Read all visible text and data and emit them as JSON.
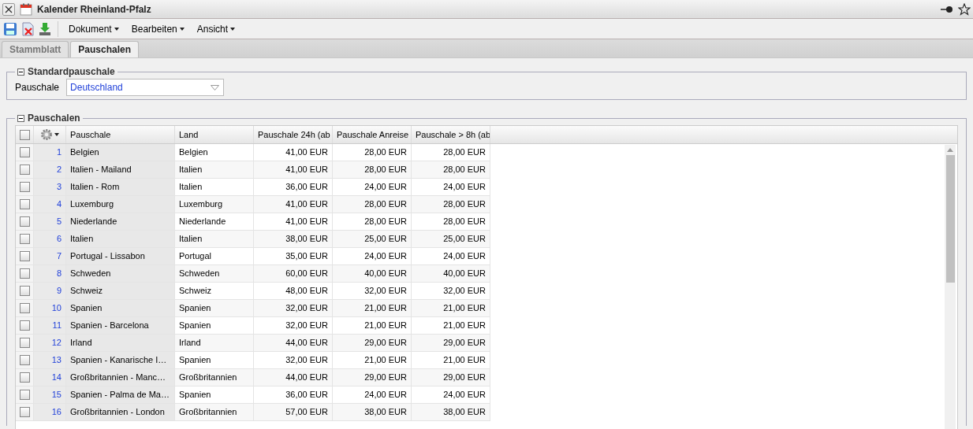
{
  "window": {
    "title": "Kalender Rheinland-Pfalz"
  },
  "menus": [
    "Dokument",
    "Bearbeiten",
    "Ansicht"
  ],
  "tabs": [
    {
      "label": "Stammblatt",
      "selected": false
    },
    {
      "label": "Pauschalen",
      "selected": true
    }
  ],
  "standard": {
    "legend": "Standardpauschale",
    "label": "Pauschale",
    "value": "Deutschland"
  },
  "table": {
    "legend": "Pauschalen",
    "all_checked": false,
    "columns": [
      "Pauschale",
      "Land",
      "Pauschale 24h (ab",
      "Pauschale Anreise",
      "Pauschale > 8h (ab"
    ],
    "rows": [
      {
        "no": "1",
        "name": "Belgien",
        "land": "Belgien",
        "p24": "41,00 EUR",
        "anreise": "28,00 EUR",
        "p8": "28,00 EUR",
        "checked": false
      },
      {
        "no": "2",
        "name": "Italien - Mailand",
        "land": "Italien",
        "p24": "41,00 EUR",
        "anreise": "28,00 EUR",
        "p8": "28,00 EUR",
        "checked": false
      },
      {
        "no": "3",
        "name": "Italien - Rom",
        "land": "Italien",
        "p24": "36,00 EUR",
        "anreise": "24,00 EUR",
        "p8": "24,00 EUR",
        "checked": false
      },
      {
        "no": "4",
        "name": "Luxemburg",
        "land": "Luxemburg",
        "p24": "41,00 EUR",
        "anreise": "28,00 EUR",
        "p8": "28,00 EUR",
        "checked": false
      },
      {
        "no": "5",
        "name": "Niederlande",
        "land": "Niederlande",
        "p24": "41,00 EUR",
        "anreise": "28,00 EUR",
        "p8": "28,00 EUR",
        "checked": false
      },
      {
        "no": "6",
        "name": "Italien",
        "land": "Italien",
        "p24": "38,00 EUR",
        "anreise": "25,00 EUR",
        "p8": "25,00 EUR",
        "checked": false
      },
      {
        "no": "7",
        "name": "Portugal - Lissabon",
        "land": "Portugal",
        "p24": "35,00 EUR",
        "anreise": "24,00 EUR",
        "p8": "24,00 EUR",
        "checked": false
      },
      {
        "no": "8",
        "name": "Schweden",
        "land": "Schweden",
        "p24": "60,00 EUR",
        "anreise": "40,00 EUR",
        "p8": "40,00 EUR",
        "checked": false
      },
      {
        "no": "9",
        "name": "Schweiz",
        "land": "Schweiz",
        "p24": "48,00 EUR",
        "anreise": "32,00 EUR",
        "p8": "32,00 EUR",
        "checked": false
      },
      {
        "no": "10",
        "name": "Spanien",
        "land": "Spanien",
        "p24": "32,00 EUR",
        "anreise": "21,00 EUR",
        "p8": "21,00 EUR",
        "checked": false
      },
      {
        "no": "11",
        "name": "Spanien - Barcelona",
        "land": "Spanien",
        "p24": "32,00 EUR",
        "anreise": "21,00 EUR",
        "p8": "21,00 EUR",
        "checked": false
      },
      {
        "no": "12",
        "name": "Irland",
        "land": "Irland",
        "p24": "44,00 EUR",
        "anreise": "29,00 EUR",
        "p8": "29,00 EUR",
        "checked": false
      },
      {
        "no": "13",
        "name": "Spanien - Kanarische I…",
        "land": "Spanien",
        "p24": "32,00 EUR",
        "anreise": "21,00 EUR",
        "p8": "21,00 EUR",
        "checked": false
      },
      {
        "no": "14",
        "name": "Großbritannien - Manc…",
        "land": "Großbritannien",
        "p24": "44,00 EUR",
        "anreise": "29,00 EUR",
        "p8": "29,00 EUR",
        "checked": false
      },
      {
        "no": "15",
        "name": "Spanien - Palma de Ma…",
        "land": "Spanien",
        "p24": "36,00 EUR",
        "anreise": "24,00 EUR",
        "p8": "24,00 EUR",
        "checked": false
      },
      {
        "no": "16",
        "name": "Großbritannien - London",
        "land": "Großbritannien",
        "p24": "57,00 EUR",
        "anreise": "38,00 EUR",
        "p8": "38,00 EUR",
        "checked": false
      }
    ]
  }
}
